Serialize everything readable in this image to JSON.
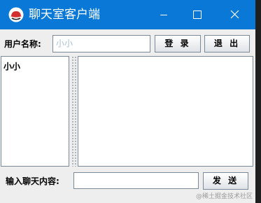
{
  "window": {
    "title": "聊天室客户端"
  },
  "login_bar": {
    "username_label": "用户名称:",
    "username_value": "小小",
    "login_button": "登 录",
    "exit_button": "退 出"
  },
  "user_list": {
    "items": [
      "小小"
    ]
  },
  "chat_area": {
    "content": ""
  },
  "message_bar": {
    "message_label": "输入聊天内容:",
    "message_value": "",
    "send_button": "发 送"
  },
  "watermark": "@稀土掘金技术社区",
  "colors": {
    "titlebar": "#0a78d7",
    "window_bg": "#eeeeee",
    "desktop_bg": "#1f1f1f",
    "app_icon": "#d32f2f"
  },
  "icons": {
    "app": "red-hat-icon",
    "minimize": "minimize-icon",
    "maximize": "maximize-icon",
    "close": "close-icon"
  }
}
